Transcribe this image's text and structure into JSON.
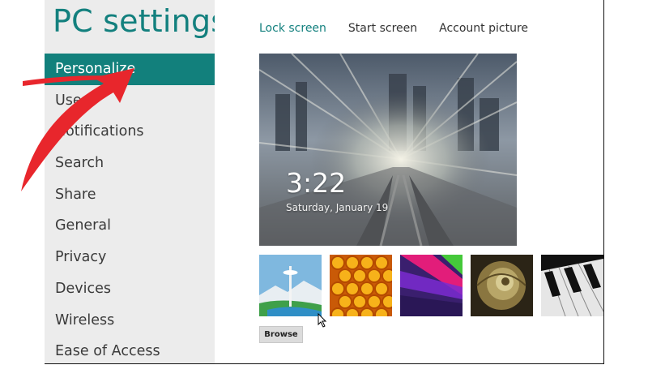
{
  "app": {
    "title": "PC settings"
  },
  "sidebar": {
    "items": [
      {
        "label": "Personalize",
        "active": true
      },
      {
        "label": "Users"
      },
      {
        "label": "Notifications"
      },
      {
        "label": "Search"
      },
      {
        "label": "Share"
      },
      {
        "label": "General"
      },
      {
        "label": "Privacy"
      },
      {
        "label": "Devices"
      },
      {
        "label": "Wireless"
      },
      {
        "label": "Ease of Access"
      }
    ]
  },
  "tabs": [
    {
      "label": "Lock screen",
      "active": true
    },
    {
      "label": "Start screen"
    },
    {
      "label": "Account picture"
    }
  ],
  "lock_preview": {
    "time": "3:22",
    "date": "Saturday, January 19"
  },
  "thumbnails": [
    {
      "name": "space-needle-thumbnail"
    },
    {
      "name": "honeycomb-thumbnail"
    },
    {
      "name": "abstract-ribbon-thumbnail"
    },
    {
      "name": "nautilus-shell-thumbnail"
    },
    {
      "name": "piano-keys-thumbnail"
    }
  ],
  "actions": {
    "browse_label": "Browse"
  },
  "colors": {
    "accent": "#12807c",
    "sidebar_bg": "#ececec",
    "annotation_arrow": "#e8262c"
  }
}
